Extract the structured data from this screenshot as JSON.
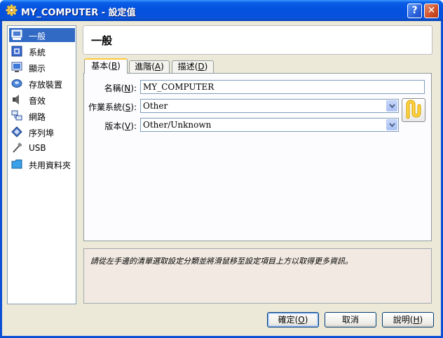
{
  "window": {
    "title": "MY_COMPUTER - 設定值",
    "help_btn": "?",
    "close_btn": "✕"
  },
  "categories": [
    {
      "label": "一般",
      "icon": "monitor-general-icon",
      "selected": true
    },
    {
      "label": "系統",
      "icon": "system-chip-icon",
      "selected": false
    },
    {
      "label": "顯示",
      "icon": "display-icon",
      "selected": false
    },
    {
      "label": "存放裝置",
      "icon": "storage-disk-icon",
      "selected": false
    },
    {
      "label": "音效",
      "icon": "audio-speaker-icon",
      "selected": false
    },
    {
      "label": "網路",
      "icon": "network-icon",
      "selected": false
    },
    {
      "label": "序列埠",
      "icon": "serial-port-icon",
      "selected": false
    },
    {
      "label": "USB",
      "icon": "usb-icon",
      "selected": false
    },
    {
      "label": "共用資料夾",
      "icon": "shared-folder-icon",
      "selected": false
    }
  ],
  "header": {
    "title": "一般"
  },
  "tabs": [
    {
      "label": "基本",
      "key": "B",
      "active": true
    },
    {
      "label": "進階",
      "key": "A",
      "active": false
    },
    {
      "label": "描述",
      "key": "D",
      "active": false
    }
  ],
  "form": {
    "name_label": "名稱",
    "name_key": "N",
    "name_value": "MY_COMPUTER",
    "os_label": "作業系統",
    "os_key": "S",
    "os_value": "Other",
    "version_label": "版本",
    "version_key": "V",
    "version_value": "Other/Unknown"
  },
  "info": {
    "text": "請從左手邊的清單選取設定分類並將滑鼠移至設定項目上方以取得更多資訊。"
  },
  "buttons": {
    "ok": "確定",
    "ok_key": "O",
    "cancel": "取消",
    "help": "說明",
    "help_key": "H"
  }
}
